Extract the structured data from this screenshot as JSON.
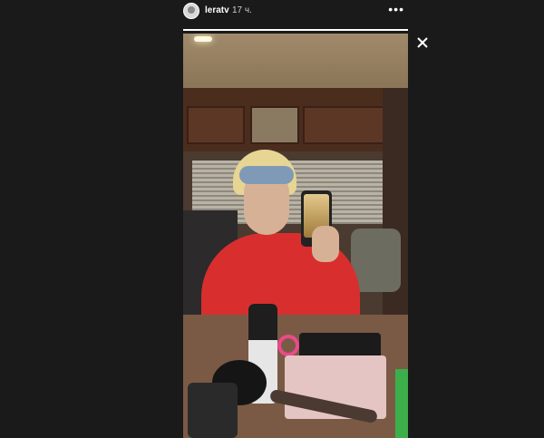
{
  "story": {
    "username": "leratv",
    "timestamp": "17 ч.",
    "more_label": "•••",
    "progress": 1.0
  },
  "icons": {
    "avatar": "avatar",
    "more": "more-icon",
    "close": "close-icon"
  }
}
